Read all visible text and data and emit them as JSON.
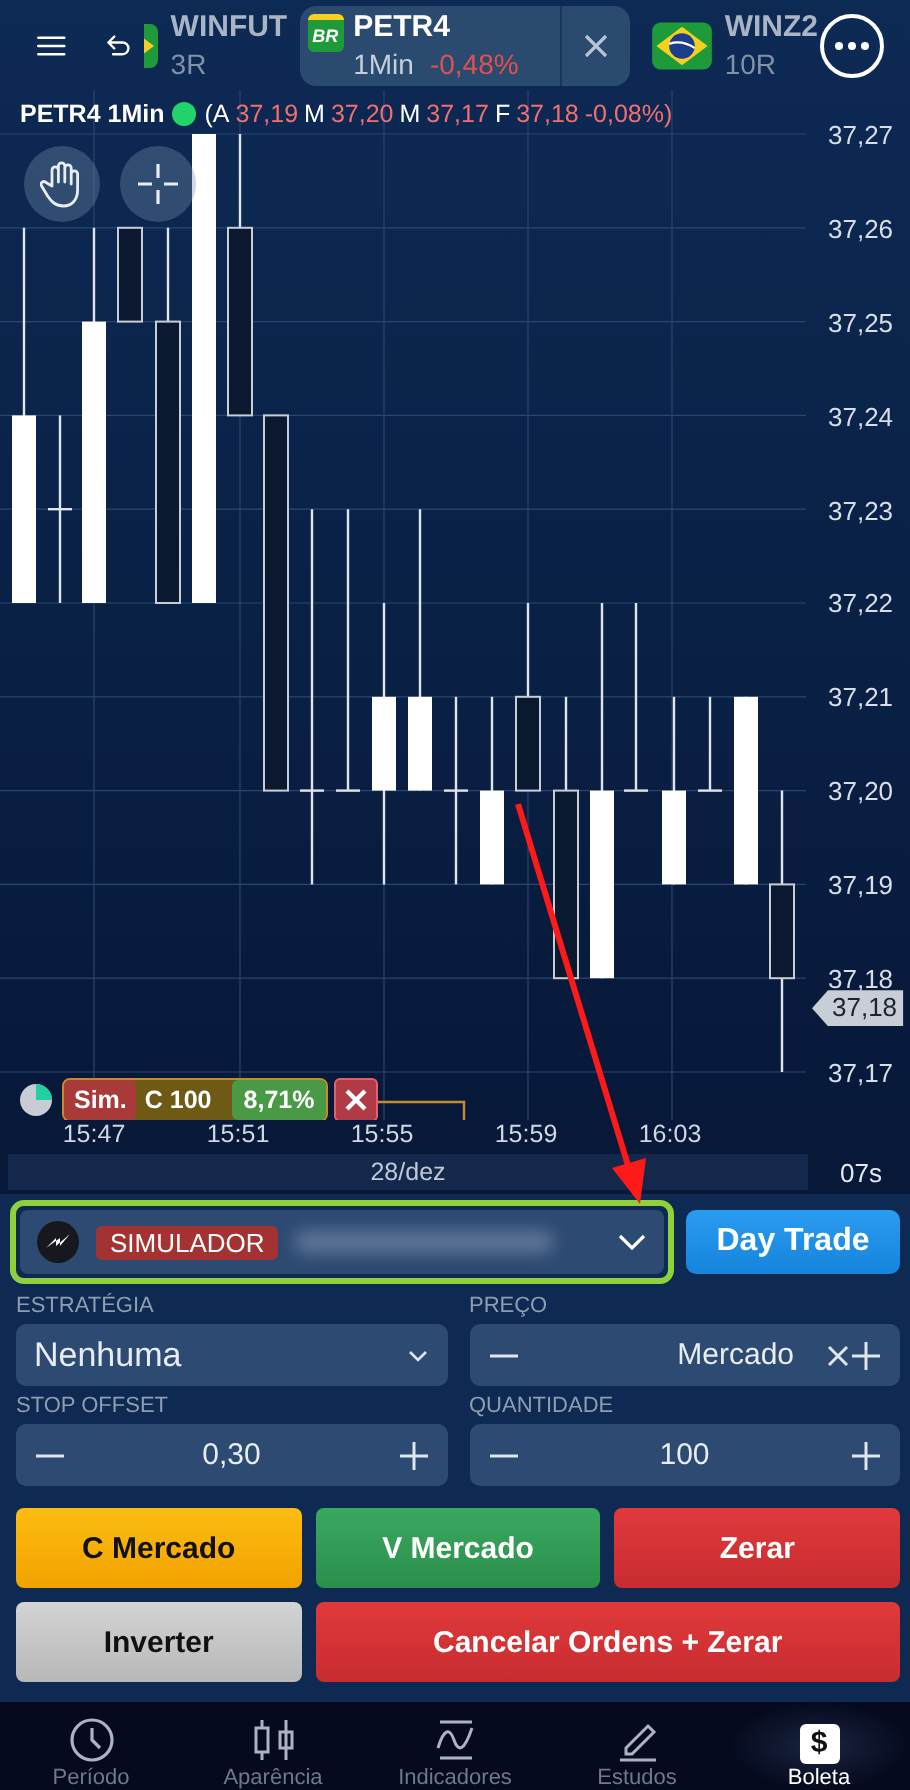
{
  "top_bar": {
    "tabs": [
      {
        "symbol": "WINFUT",
        "detail": "3R",
        "selected": false,
        "kind": "flag_partial"
      },
      {
        "symbol": "PETR4",
        "detail": "1Min",
        "change": "-0,48%",
        "selected": true,
        "kind": "logo",
        "logo_text": "BR"
      },
      {
        "symbol": "WINZ2",
        "detail": "10R",
        "selected": false,
        "kind": "flag"
      }
    ]
  },
  "chart": {
    "title": "PETR4 1Min",
    "live": true,
    "quote": [
      {
        "label": "(A",
        "value": "37,19"
      },
      {
        "label": "M",
        "value": "37,20"
      },
      {
        "label": "M",
        "value": "37,17"
      },
      {
        "label": "F",
        "value": "37,18"
      }
    ],
    "quote_change": "-0,08%)",
    "price_axis": [
      "37,27",
      "37,26",
      "37,25",
      "37,24",
      "37,23",
      "37,22",
      "37,21",
      "37,20",
      "37,19",
      "37,18",
      "37,17"
    ],
    "last_price": "37,18",
    "time_axis": [
      "15:47",
      "15:51",
      "15:55",
      "15:59",
      "16:03"
    ],
    "date": "28/dez",
    "countdown": "07s",
    "position": {
      "account_tag": "Sim.",
      "side": "C 100",
      "result": "8,71%"
    }
  },
  "order_ticket": {
    "account_tag": "SIMULADOR",
    "mode_button": "Day Trade",
    "fields": [
      {
        "label": "ESTRATÉGIA",
        "value": "Nenhuma",
        "kind": "select"
      },
      {
        "label": "PREÇO",
        "value": "Mercado",
        "kind": "price"
      },
      {
        "label": "STOP OFFSET",
        "value": "0,30",
        "kind": "stepper"
      },
      {
        "label": "QUANTIDADE",
        "value": "100",
        "kind": "stepper"
      }
    ],
    "buttons": [
      {
        "label": "C Mercado",
        "kind": "buy"
      },
      {
        "label": "V Mercado",
        "kind": "sell"
      },
      {
        "label": "Zerar",
        "kind": "danger"
      },
      {
        "label": "Inverter",
        "kind": "neutral"
      },
      {
        "label": "Cancelar Ordens + Zerar",
        "kind": "danger"
      }
    ]
  },
  "bottom_nav": [
    {
      "label": "Período",
      "kind": "clock",
      "selected": false
    },
    {
      "label": "Aparência",
      "kind": "candles",
      "selected": false
    },
    {
      "label": "Indicadores",
      "kind": "indicator",
      "selected": false
    },
    {
      "label": "Estudos",
      "kind": "pencil",
      "selected": false
    },
    {
      "label": "Boleta",
      "kind": "glyph",
      "glyph": "$",
      "selected": true
    }
  ]
}
